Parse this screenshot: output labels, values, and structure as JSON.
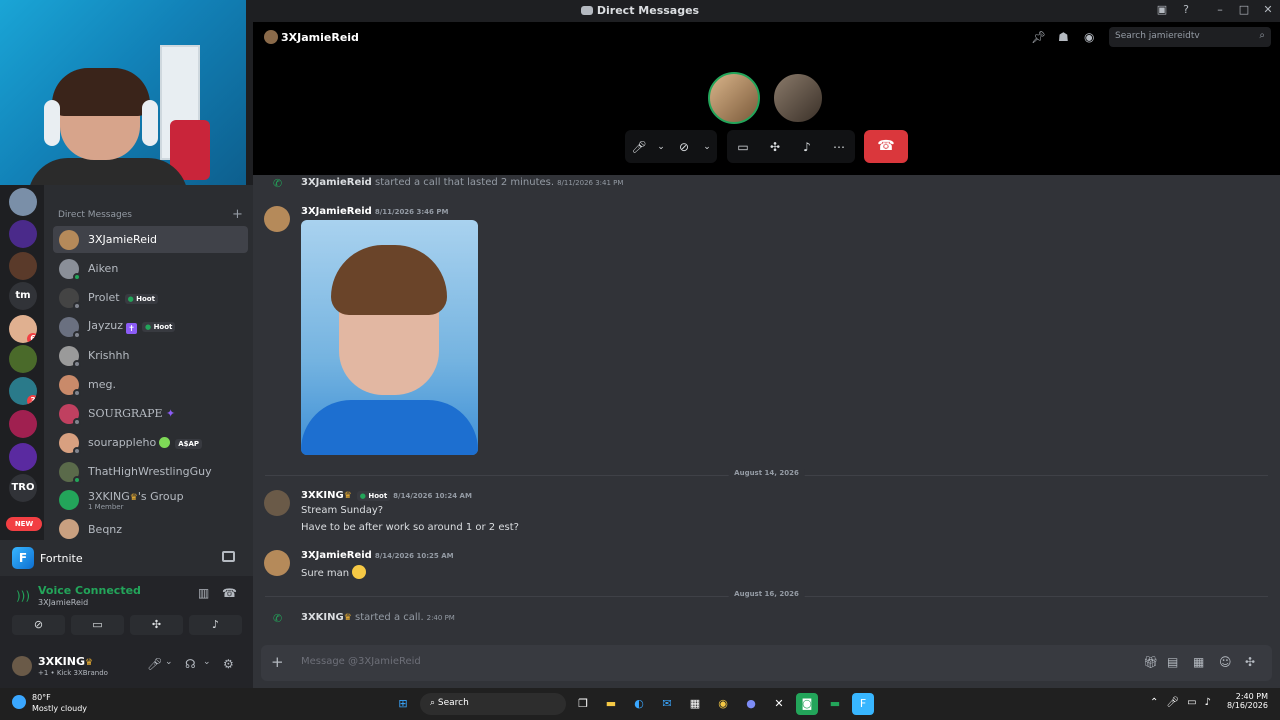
{
  "window": {
    "title": "Direct Messages"
  },
  "dm_list": {
    "header": "Direct Messages",
    "add": "+",
    "items": [
      {
        "name": "3XJamieReid",
        "active": true
      },
      {
        "name": "Aiken"
      },
      {
        "name": "Prolet",
        "tag": "Hoot"
      },
      {
        "name": "Jayzuz",
        "tag": "Hoot"
      },
      {
        "name": "Krishhh"
      },
      {
        "name": "meg."
      },
      {
        "name": "SOURGRAPE"
      },
      {
        "name": "sourappleho",
        "tag": "A$AP"
      },
      {
        "name": "ThatHighWrestlingGuy"
      },
      {
        "name": "3XKING",
        "suffix": "'s Group",
        "sub": "1 Member"
      },
      {
        "name": "Beqnz"
      }
    ]
  },
  "servers": {
    "tm": "tm",
    "tro": "TRO",
    "badge1": "6",
    "badge2": "3",
    "new": "NEW"
  },
  "activity": {
    "name": "Fortnite"
  },
  "voice": {
    "status": "Voice Connected",
    "channel": "3XJamieReid"
  },
  "user": {
    "name": "3XKING",
    "sub": "+1 • Kick 3XBrando"
  },
  "header": {
    "name": "3XJamieReid",
    "search_placeholder": "Search jamiereidtv"
  },
  "messages": {
    "sys1_name": "3XJamieReid",
    "sys1_text": "started a call that lasted 2 minutes.",
    "sys1_time": "8/11/2026 3:41 PM",
    "m1_name": "3XJamieReid",
    "m1_time": "8/11/2026 3:46 PM",
    "div1": "August 14, 2026",
    "m2_name": "3XKING",
    "m2_tag": "Hoot",
    "m2_time": "8/14/2026 10:24 AM",
    "m2_line1": "Stream Sunday?",
    "m2_line2": "Have to be after work so around 1 or 2 est?",
    "m3_name": "3XJamieReid",
    "m3_time": "8/14/2026 10:25 AM",
    "m3_text": "Sure man",
    "div2": "August 16, 2026",
    "sys2_name": "3XKING",
    "sys2_text": "started a call.",
    "sys2_time": "2:40 PM"
  },
  "composer": {
    "placeholder": "Message @3XJamieReid"
  },
  "taskbar": {
    "temp": "80°F",
    "weather": "Mostly cloudy",
    "search": "Search",
    "time": "2:40 PM",
    "date": "8/16/2026"
  },
  "colors": {
    "accent": "#23a55a",
    "danger": "#da373c",
    "bg": "#313338"
  }
}
